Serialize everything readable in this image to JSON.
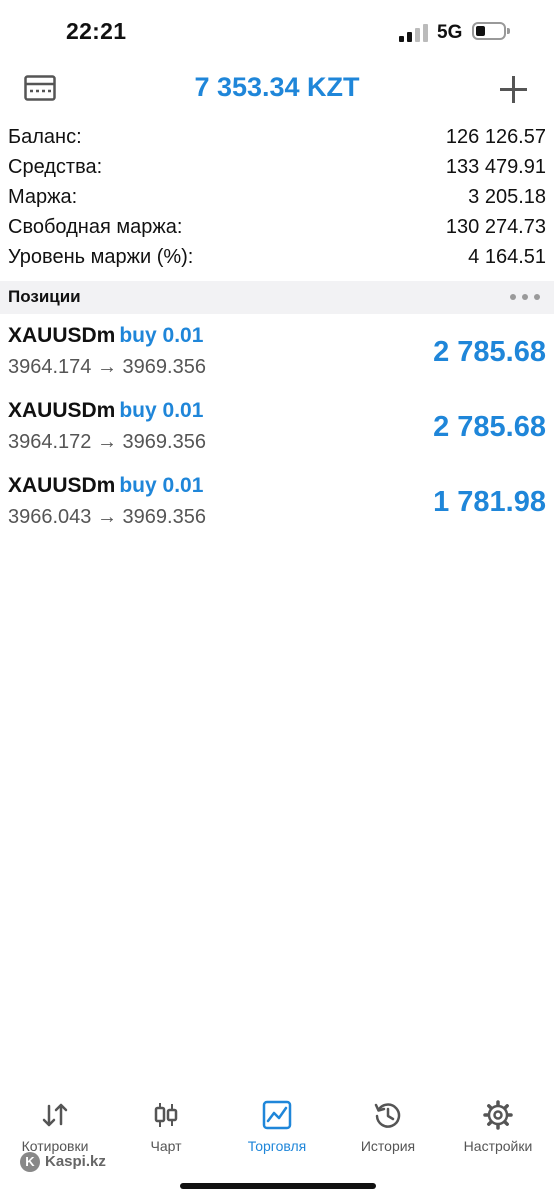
{
  "status": {
    "time": "22:21",
    "network": "5G"
  },
  "header": {
    "title": "7 353.34 KZT"
  },
  "summary": [
    {
      "label": "Баланс:",
      "value": "126 126.57"
    },
    {
      "label": "Средства:",
      "value": "133 479.91"
    },
    {
      "label": "Маржа:",
      "value": "3 205.18"
    },
    {
      "label": "Свободная маржа:",
      "value": "130 274.73"
    },
    {
      "label": "Уровень маржи (%):",
      "value": "4 164.51"
    }
  ],
  "positions": {
    "title": "Позиции",
    "items": [
      {
        "symbol": "XAUUSDm",
        "side": "buy 0.01",
        "prices": "3964.174 → 3969.356",
        "profit": "2 785.68"
      },
      {
        "symbol": "XAUUSDm",
        "side": "buy 0.01",
        "prices": "3964.172 → 3969.356",
        "profit": "2 785.68"
      },
      {
        "symbol": "XAUUSDm",
        "side": "buy 0.01",
        "prices": "3966.043 → 3969.356",
        "profit": "1 781.98"
      }
    ]
  },
  "tabs": [
    {
      "label": "Котировки",
      "icon": "arrows-updown-icon"
    },
    {
      "label": "Чарт",
      "icon": "candlestick-icon"
    },
    {
      "label": "Торговля",
      "icon": "trade-chart-icon",
      "active": true
    },
    {
      "label": "История",
      "icon": "history-icon"
    },
    {
      "label": "Настройки",
      "icon": "gear-icon"
    }
  ],
  "watermark": "Kaspi.kz",
  "colors": {
    "accent": "#1f86d9"
  }
}
